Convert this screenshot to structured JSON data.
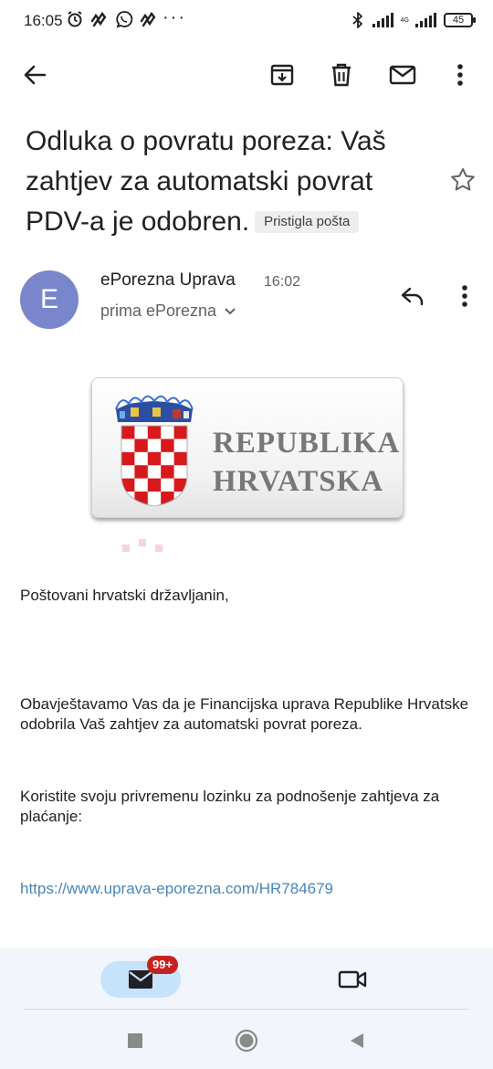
{
  "status_bar": {
    "time": "16:05",
    "dots": "···",
    "network": "4G",
    "battery": "45"
  },
  "toolbar": {
    "back_icon": "arrow-left-icon",
    "archive_icon": "archive-icon",
    "delete_icon": "trash-icon",
    "mark_unread_icon": "mail-icon",
    "more_icon": "more-vert-icon"
  },
  "email": {
    "subject": "Odluka o povratu poreza: Vaš zahtjev za automatski povrat PDV-a je odobren.",
    "label": "Pristigla pošta",
    "sender_initial": "E",
    "sender_name": "ePorezna Uprava",
    "time": "16:02",
    "recipient": "prima ePorezna",
    "logo_text_line1": "REPUBLIKA",
    "logo_text_line2": "HRVATSKA",
    "greeting": "Poštovani hrvatski državljanin,",
    "paragraph1": "Obavještavamo Vas da je Financijska uprava Republike Hrvatske odobrila Vaš zahtjev za automatski povrat poreza.",
    "paragraph2": "Koristite svoju privremenu lozinku za podnošenje zahtjeva za plaćanje:",
    "link": "https://www.uprava-eporezna.com/HR784679"
  },
  "bottom_nav": {
    "mail_badge": "99+",
    "mail_icon": "mail-icon",
    "meet_icon": "video-icon"
  },
  "colors": {
    "avatar": "#7986cb",
    "badge": "#c5221f",
    "nav_active": "#c7e3fb",
    "link": "#4a86b8"
  }
}
